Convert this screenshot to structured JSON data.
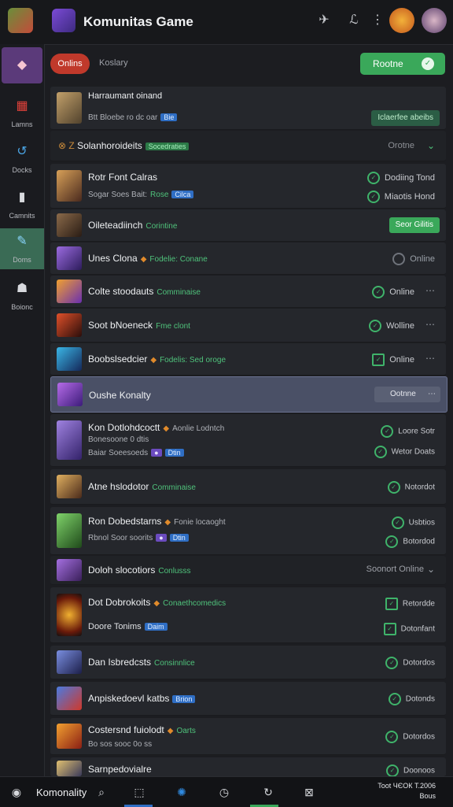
{
  "header": {
    "title": "Komunitas Game"
  },
  "sidebar": {
    "items": [
      {
        "label": "Lamns",
        "icon": "game-icon"
      },
      {
        "label": "Docks",
        "icon": "controller-icon"
      },
      {
        "label": "Camnits",
        "icon": "building-icon"
      },
      {
        "label": "Doms",
        "icon": "edit-icon"
      },
      {
        "label": "Boionc",
        "icon": "group-icon"
      }
    ]
  },
  "filters": {
    "online_chip": "Onlins",
    "secondary": "Koslary",
    "online_button": "Rootne",
    "online_button_check": "✓"
  },
  "rows": [
    {
      "name": "Harraumant oinand",
      "sub": "Btt Bloebe ro dc oar",
      "sub_tag": "Bie",
      "button": "Iclaerfee abeibs"
    },
    {
      "name": "Solanhoroideits",
      "prefix": "⊗ Z",
      "tag": "Socedraties",
      "right": "Orotne"
    },
    {
      "name": "Rotr Font Calras",
      "sub": "Sogar Soes Bait:",
      "sub_green": "Rose",
      "sub_tag": "Cilca",
      "right1": "Dodiing Tond",
      "right2": "Miaotis Hond"
    },
    {
      "name": "Oileteadiinch",
      "green": "Corintine",
      "button": "Seor Gilitis"
    },
    {
      "name": "Unes Clona",
      "green": "Fodelie: Conane",
      "right": "Online"
    },
    {
      "name": "Colte stoodauts",
      "green": "Comminaise",
      "right": "Online"
    },
    {
      "name": "Soot bNoeneck",
      "green": "Fme clont",
      "right": "Wolline"
    },
    {
      "name": "Boobslsedcier",
      "green": "Fodelis: Sed oroge",
      "right": "Online"
    },
    {
      "name": "Oushe Konalty",
      "button": "Ootnne"
    },
    {
      "name": "Kon Dotlohdcoctt",
      "green": "Aonlie Lodntch",
      "sub": "Bonesoone 0 dtis",
      "sub2": "Baiar Soeesoeds",
      "sub_tag": "Dtin",
      "right1": "Loore Sotr",
      "right2": "Wetor Doats"
    },
    {
      "name": "Atne hslodotor",
      "green": "Comminaise",
      "right": "Notordot"
    },
    {
      "name": "Ron Dobedstarns",
      "green": "Fonie locaoght",
      "sub": "Rbnol Soor soorits",
      "sub_tag": "Dtin",
      "right1": "Usbtios",
      "right2": "Botordod"
    },
    {
      "name": "Doloh slocotiors",
      "green": "Conlusss",
      "right": "Soonort Online"
    },
    {
      "name": "Dot Dobrokoits",
      "green": "Conaethcomedics",
      "sub": "Doore Tonims",
      "sub_tag": "Daim",
      "right1": "Retordde",
      "right2": "Dotonfant"
    },
    {
      "name": "Dan Isbredcsts",
      "green": "Consinnlice",
      "right": "Dotordos"
    },
    {
      "name": "Anpiskedoevl katbs",
      "tag": "Brion",
      "right": "Dotonds"
    },
    {
      "name": "Costersnd fuiolodt",
      "green": "Oarts",
      "sub": "Bo sos sooc 0o ss",
      "right": "Dotordos"
    },
    {
      "name": "Sarnpedovialre",
      "right": "Doonoos"
    }
  ],
  "bottom": {
    "label": "Komonality",
    "status1": "Toot ЧЄОК Т.2006",
    "status2": "Bous"
  },
  "colors": {
    "accent_green": "#3aa85a",
    "danger_red": "#c0392b",
    "selected": "#4a5066"
  }
}
